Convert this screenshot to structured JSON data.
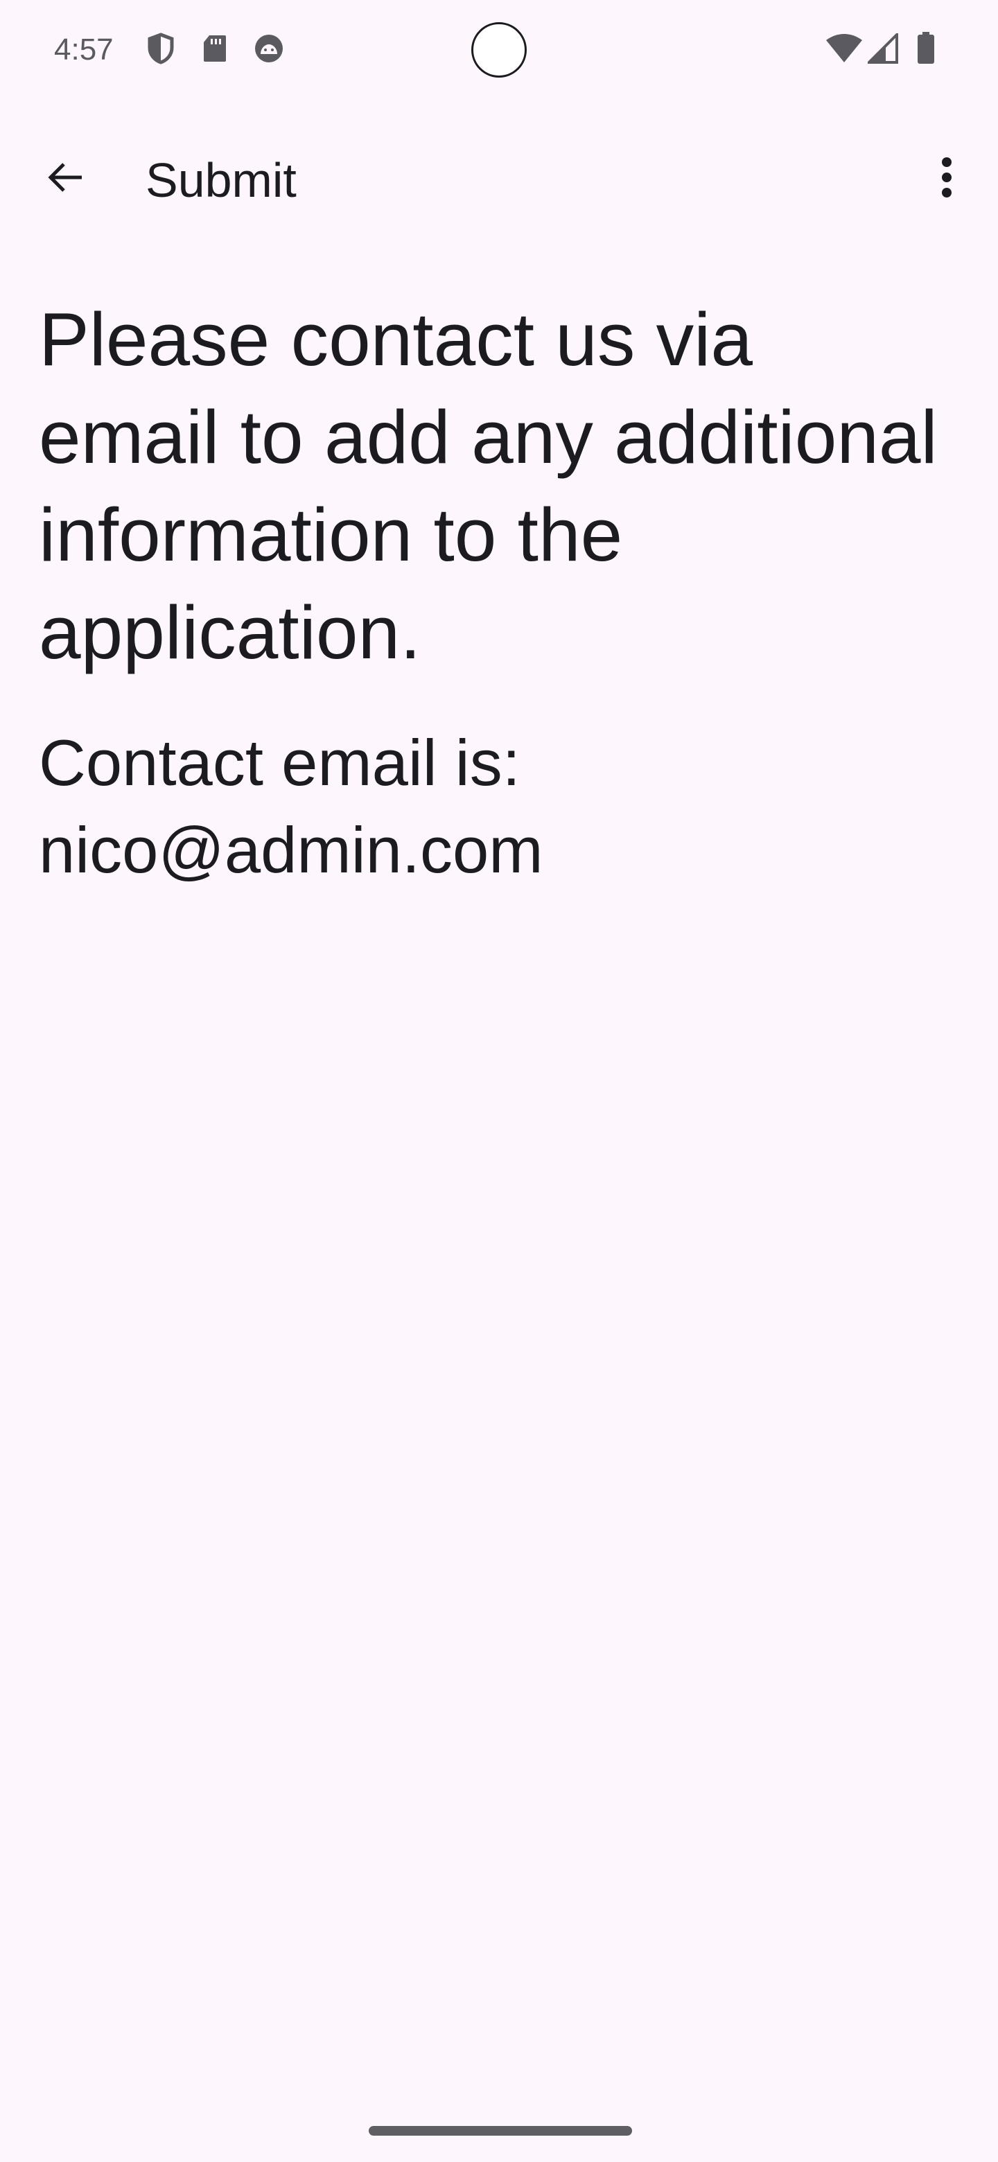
{
  "status_bar": {
    "time": "4:57",
    "left_icons": [
      "shield-icon",
      "sd-card-icon",
      "android-debug-icon"
    ],
    "right_icons": [
      "wifi-icon",
      "cellular-signal-icon",
      "battery-icon"
    ]
  },
  "app_bar": {
    "title": "Submit",
    "back_icon": "arrow-back-icon",
    "menu_icon": "more-vert-icon"
  },
  "content": {
    "message": "Please contact us via email to add any additional information to the application.",
    "contact_line1": "Contact email is:",
    "contact_line2": "nico@admin.com"
  },
  "colors": {
    "background": "#fdf7fd",
    "text": "#1c1b1f",
    "status_text": "#5b5a60"
  }
}
